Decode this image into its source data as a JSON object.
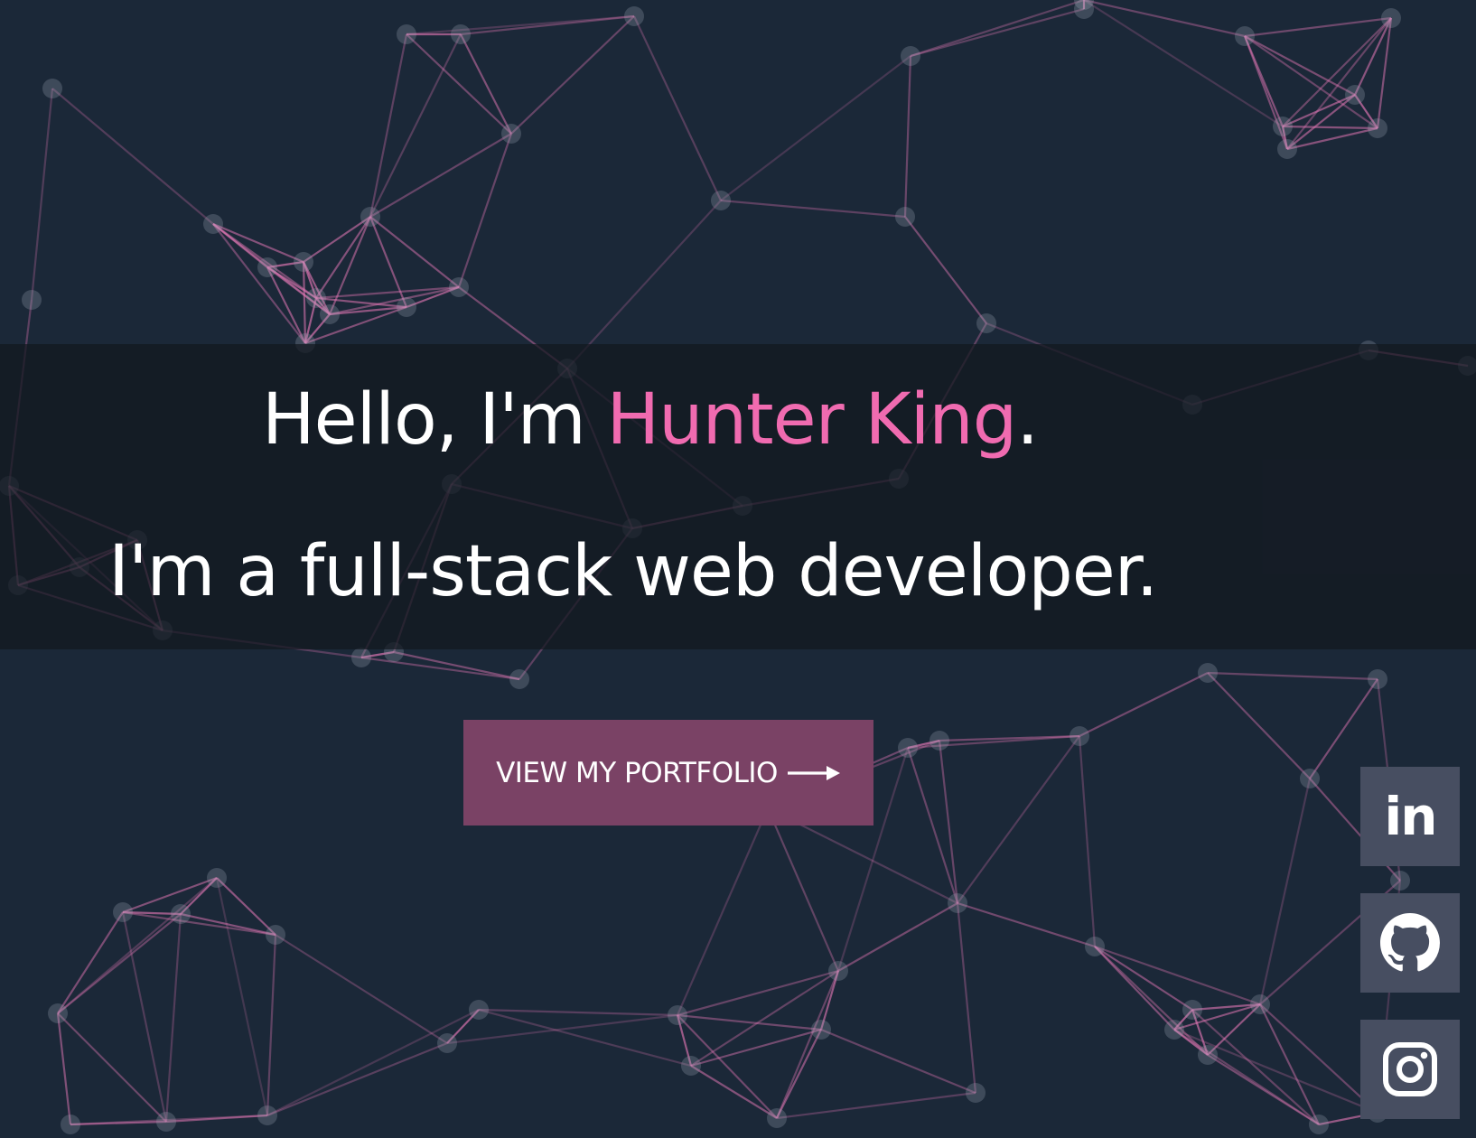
{
  "hero": {
    "greeting_prefix": "Hello, I'm ",
    "name": "Hunter King",
    "greeting_suffix": ".",
    "tagline": "I'm a full-stack web developer."
  },
  "cta": {
    "label": "VIEW MY PORTFOLIO",
    "icon": "arrow-right-icon"
  },
  "social": [
    {
      "name": "LinkedIn",
      "icon": "linkedin-icon",
      "glyph": "in"
    },
    {
      "name": "GitHub",
      "icon": "github-icon"
    },
    {
      "name": "Instagram",
      "icon": "instagram-icon"
    }
  ],
  "colors": {
    "background": "#1b2838",
    "accent": "#f06bb0",
    "network_line": "#e377b5",
    "button": "#7a4265",
    "social_tile": "#474e61",
    "text": "#ffffff"
  }
}
